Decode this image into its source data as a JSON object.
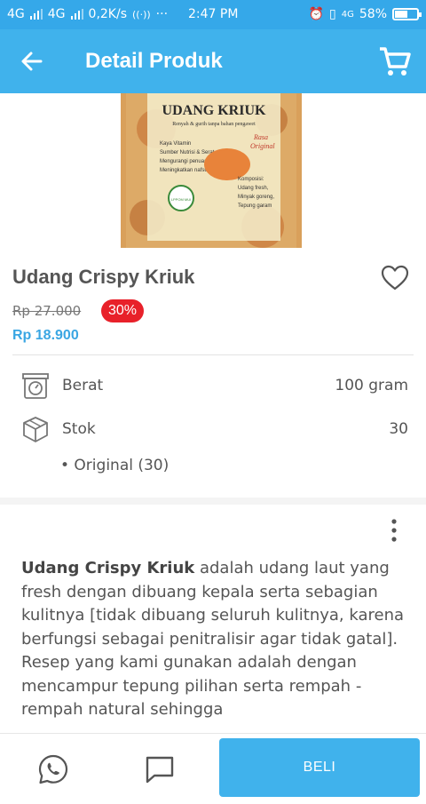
{
  "status_bar": {
    "net1": "4G",
    "net2": "4G",
    "speed": "0,2K/s",
    "dots": "···",
    "time": "2:47 PM",
    "net_right": "4G",
    "battery": "58%",
    "battery_level": 0.58
  },
  "appbar": {
    "title": "Detail Produk",
    "back_icon": "arrow-left-icon",
    "cart_icon": "cart-icon"
  },
  "product": {
    "image_texts": {
      "brand": "UDANG KRIUK",
      "tagline": "Renyah & gurih tanpa bahan pengawet",
      "flavor1": "Rasa",
      "flavor2": "Original",
      "benefits": [
        "Kaya Vitamin",
        "Sumber Nutrisi & Serat",
        "Mengurangi penuaan",
        "Meningkatkan nafsu makan"
      ],
      "composition_title": "Komposisi:",
      "composition": [
        "Udang fresh,",
        "Minyak goreng,",
        "Tepung garam"
      ],
      "halal": "LPPOM MUI"
    },
    "name": "Udang Crispy Kriuk",
    "old_price": "Rp 27.000",
    "discount": "30%",
    "price": "Rp 18.900",
    "specs": [
      {
        "label": "Berat",
        "value": "100 gram",
        "icon": "scale-icon"
      },
      {
        "label": "Stok",
        "value": "30",
        "icon": "box-icon"
      }
    ],
    "variant": "• Original (30)",
    "description_bold": "Udang Crispy Kriuk",
    "description_rest": " adalah udang laut yang fresh dengan dibuang kepala serta sebagian kulitnya [tidak dibuang seluruh kulitnya, karena berfungsi sebagai penitralisir agar tidak gatal]. Resep yang kami gunakan adalah dengan mencampur tepung pilihan serta rempah - rempah natural sehingga"
  },
  "bottom_bar": {
    "whatsapp_icon": "whatsapp-icon",
    "chat_icon": "chat-icon",
    "buy_label": "BELI"
  },
  "colors": {
    "primary": "#40b2ec",
    "status": "#35a8e9",
    "discount": "#e8212a",
    "price": "#3aa6e3"
  }
}
